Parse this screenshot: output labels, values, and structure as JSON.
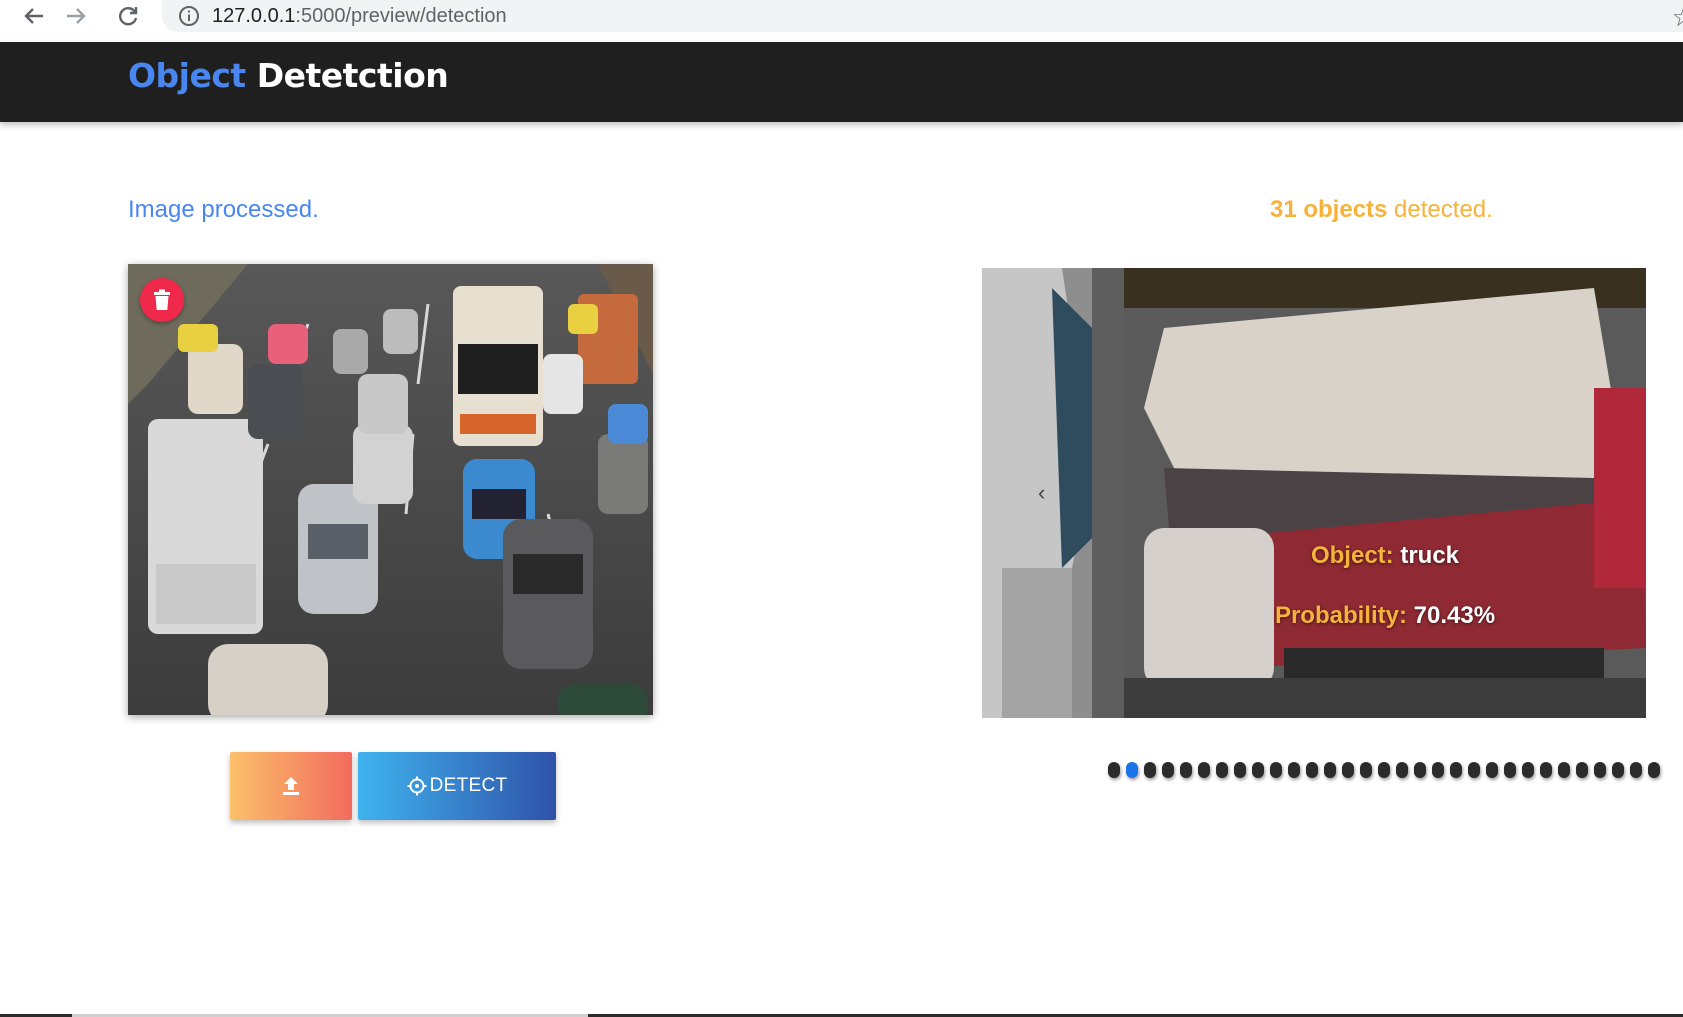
{
  "browser": {
    "url_host": "127.0.0.1",
    "url_path": ":5000/preview/detection",
    "icons": [
      "back-arrow-icon",
      "forward-arrow-icon",
      "reload-icon",
      "info-icon",
      "star-icon"
    ]
  },
  "header": {
    "brand_part1": "Object",
    "brand_part2": "Detetction"
  },
  "status": {
    "processed_text": "Image processed.",
    "count_strong": "31 objects",
    "count_rest": " detected."
  },
  "actions": {
    "detect_label": "DETECT",
    "upload_icon": "upload-icon",
    "detect_icon": "crosshair-icon",
    "delete_icon": "trash-icon"
  },
  "result": {
    "object_key": "Object:",
    "object_value": "truck",
    "prob_key": "Probability:",
    "prob_value": "70.43%"
  },
  "carousel": {
    "total_slides": 31,
    "active_index": 1
  },
  "colors": {
    "header_bg": "#1f1f1f",
    "brand_accent": "#4a86f0",
    "highlight": "#f6b23a",
    "delete": "#f0284a",
    "dot_active": "#1a73e8"
  }
}
